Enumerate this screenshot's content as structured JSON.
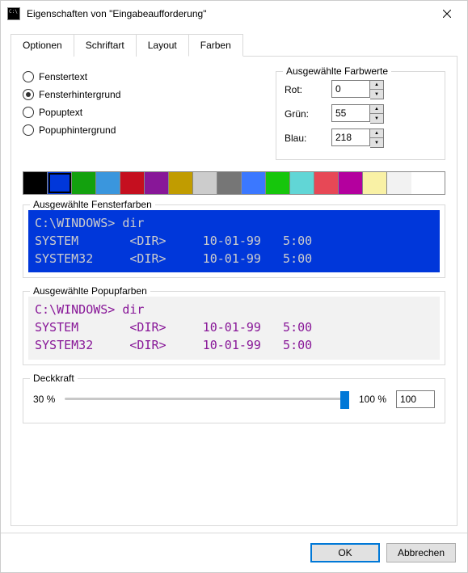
{
  "window": {
    "title": "Eigenschaften von \"Eingabeaufforderung\""
  },
  "tabs": {
    "items": [
      {
        "label": "Optionen"
      },
      {
        "label": "Schriftart"
      },
      {
        "label": "Layout"
      },
      {
        "label": "Farben"
      }
    ],
    "active_index": 3
  },
  "radios": {
    "items": [
      {
        "label": "Fenstertext",
        "checked": false
      },
      {
        "label": "Fensterhintergrund",
        "checked": true
      },
      {
        "label": "Popuptext",
        "checked": false
      },
      {
        "label": "Popuphintergrund",
        "checked": false
      }
    ]
  },
  "rgb_group": {
    "title": "Ausgewählte Farbwerte",
    "rows": [
      {
        "label": "Rot:",
        "value": "0"
      },
      {
        "label": "Grün:",
        "value": "55"
      },
      {
        "label": "Blau:",
        "value": "218"
      }
    ]
  },
  "palette": {
    "selected_index": 1,
    "colors": [
      "#000000",
      "#0037DA",
      "#13A10E",
      "#3A96DD",
      "#C50F1F",
      "#881798",
      "#C19C00",
      "#CCCCCC",
      "#767676",
      "#3B78FF",
      "#16C60C",
      "#61D6D6",
      "#E74856",
      "#B4009E",
      "#F9F1A5",
      "#F2F2F2"
    ]
  },
  "preview_window": {
    "label": "Ausgewählte Fensterfarben",
    "bg": "#0037DA",
    "fg": "#CCCCCC",
    "line1": "C:\\WINDOWS> dir",
    "line2": "SYSTEM       <DIR>     10-01-99   5:00",
    "line3": "SYSTEM32     <DIR>     10-01-99   5:00"
  },
  "preview_popup": {
    "label": "Ausgewählte Popupfarben",
    "bg": "#F2F2F2",
    "fg": "#881798",
    "line1": "C:\\WINDOWS> dir",
    "line2": "SYSTEM       <DIR>     10-01-99   5:00",
    "line3": "SYSTEM32     <DIR>     10-01-99   5:00"
  },
  "opacity": {
    "label": "Deckkraft",
    "min_label": "30 %",
    "max_label": "100 %",
    "value": "100"
  },
  "buttons": {
    "ok": "OK",
    "cancel": "Abbrechen"
  }
}
